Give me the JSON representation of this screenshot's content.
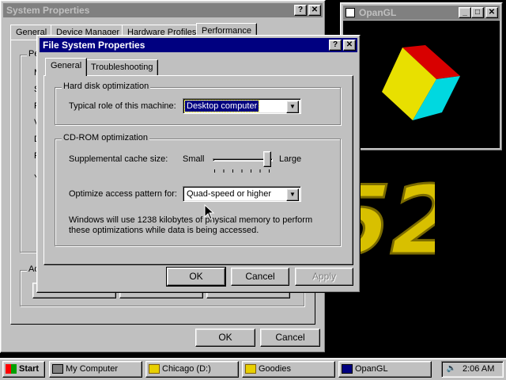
{
  "colors": {
    "desktop": "#000000",
    "window": "#c0c0c0",
    "active_title": "#000080",
    "inactive_title": "#808080",
    "cube_yellow": "#e8e000",
    "cube_cyan": "#00d8e0",
    "cube_red": "#d80000",
    "logo_gold": "#d8c000"
  },
  "system_props": {
    "title": "System Properties",
    "tabs": [
      "General",
      "Device Manager",
      "Hardware Profiles",
      "Performance"
    ],
    "group_fragment": "Pe",
    "side_letters": [
      "M",
      "S",
      "F",
      "V",
      "D",
      "F",
      "Y"
    ],
    "bottom_fragment": "Ad",
    "ok": "OK",
    "cancel": "Cancel"
  },
  "opengl": {
    "title": "OpanGL",
    "logo_text": "52"
  },
  "fs_props": {
    "title": "File System Properties",
    "tabs": [
      "General",
      "Troubleshooting"
    ],
    "hdd_group": "Hard disk optimization",
    "role_label": "Typical role of this machine:",
    "role_value": "Desktop computer",
    "cd_group": "CD-ROM optimization",
    "cache_label": "Supplemental cache size:",
    "cache_small": "Small",
    "cache_large": "Large",
    "cache_level": 1.0,
    "access_label": "Optimize access pattern for:",
    "access_value": "Quad-speed or higher",
    "info_line1": "Windows will use 1238 kilobytes of physical memory to perform",
    "info_line2": "these optimizations while data is being accessed.",
    "ok": "OK",
    "cancel": "Cancel",
    "apply": "Apply"
  },
  "taskbar": {
    "start": "Start",
    "items": [
      "My Computer",
      "Chicago (D:)",
      "Goodies",
      "OpanGL"
    ],
    "time": "2:06 AM"
  }
}
